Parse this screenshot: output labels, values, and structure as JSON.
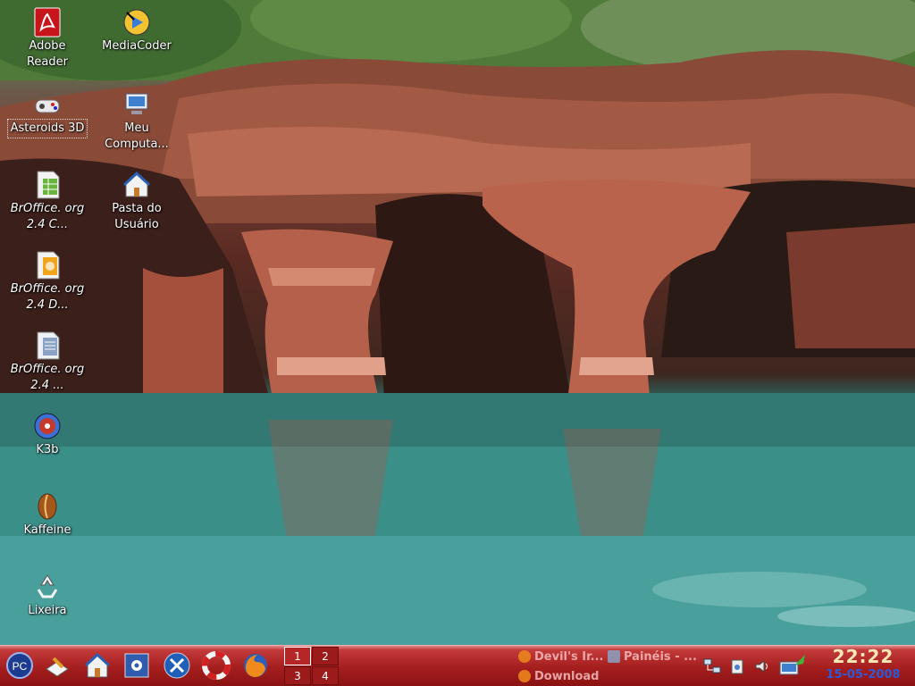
{
  "desktop": {
    "icons": [
      {
        "label": "Adobe Reader",
        "icon": "adobe-reader-icon"
      },
      {
        "label": "MediaCoder",
        "icon": "mediacoder-icon"
      },
      {
        "label": "Asteroids 3D",
        "icon": "gamepad-icon"
      },
      {
        "label": "Meu Computa...",
        "icon": "computer-icon"
      },
      {
        "label": "BrOffice. org 2.4 C...",
        "icon": "broffice-calc-icon"
      },
      {
        "label": "Pasta do Usuário",
        "icon": "home-folder-icon"
      },
      {
        "label": "BrOffice. org 2.4 D...",
        "icon": "broffice-draw-icon"
      },
      {
        "label": "BrOffice. org 2.4 ...",
        "icon": "broffice-writer-icon"
      },
      {
        "label": "K3b",
        "icon": "k3b-icon"
      },
      {
        "label": "Kaffeine",
        "icon": "kaffeine-icon"
      },
      {
        "label": "Lixeira",
        "icon": "trash-icon"
      }
    ]
  },
  "taskbar": {
    "launchers": [
      {
        "icon": "pc-menu-icon",
        "label": "PC"
      },
      {
        "icon": "text-editor-icon"
      },
      {
        "icon": "home-icon"
      },
      {
        "icon": "control-panel-icon"
      },
      {
        "icon": "system-tools-icon"
      },
      {
        "icon": "lifebuoy-icon"
      },
      {
        "icon": "firefox-icon"
      }
    ],
    "pager": [
      "1",
      "2",
      "3",
      "4"
    ],
    "tasks": [
      {
        "label": "Devil's Ir...",
        "icon": "firefox-icon"
      },
      {
        "label": "Painéis - ...",
        "icon": "panels-icon"
      },
      {
        "label": "Download",
        "icon": "firefox-icon"
      }
    ],
    "tray": [
      "network-icon",
      "clipboard-icon",
      "volume-icon",
      "update-manager-icon"
    ],
    "clock": {
      "time": "22:22",
      "date": "15-05-2008"
    }
  },
  "colors": {
    "taskbar": "#a51e1e",
    "clock_time": "#fbe9b5",
    "clock_date": "#2b5bd8"
  }
}
